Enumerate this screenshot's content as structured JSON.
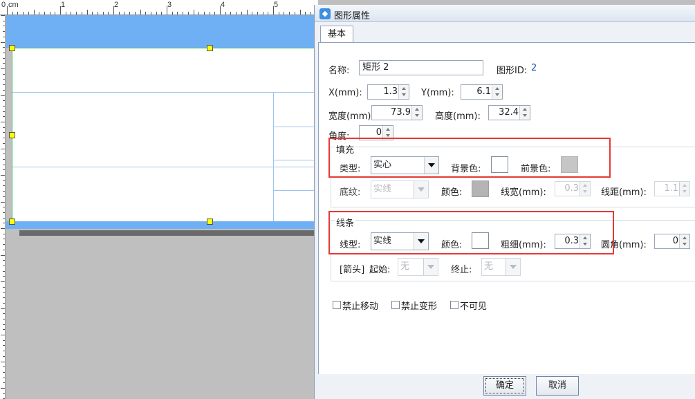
{
  "ruler": {
    "unit": "cm",
    "labels": [
      "1",
      "2",
      "3",
      "4",
      "5"
    ]
  },
  "dialog": {
    "title": "图形属性",
    "tab": "基本",
    "name_label": "名称:",
    "name_value": "矩形 2",
    "shape_id_label": "图形ID:",
    "shape_id_value": "2",
    "x_label": "X(mm):",
    "x_value": "1.3",
    "y_label": "Y(mm):",
    "y_value": "6.1",
    "width_label": "宽度(mm):",
    "width_value": "73.9",
    "height_label": "高度(mm):",
    "height_value": "32.4",
    "angle_label": "角度:",
    "angle_value": "0",
    "fill": {
      "section_title": "填充",
      "type_label": "类型:",
      "type_value": "实心",
      "bg_color_label": "背景色:",
      "bg_color": "#ffffff",
      "fg_color_label": "前景色:",
      "fg_color": "#c6c6c6",
      "pattern_label": "底纹:",
      "pattern_value": "实线",
      "color_label": "颜色:",
      "color": "#b4b4b4",
      "line_width_label": "线宽(mm):",
      "line_width_value": "0.3",
      "line_spacing_label": "线距(mm):",
      "line_spacing_value": "1.1"
    },
    "line": {
      "section_title": "线条",
      "type_label": "线型:",
      "type_value": "实线",
      "color_label": "颜色:",
      "color": "#ffffff",
      "thickness_label": "粗细(mm):",
      "thickness_value": "0.3",
      "corner_label": "圆角(mm):",
      "corner_value": "0",
      "arrow_label": "[箭头]",
      "start_label": "起始:",
      "start_value": "无",
      "end_label": "终止:",
      "end_value": "无"
    },
    "checkboxes": {
      "lock_move": "禁止移动",
      "lock_resize": "禁止变形",
      "invisible": "不可见"
    },
    "ok_button": "确定",
    "cancel_button": "取消"
  },
  "colors": {
    "band": "#6fb0f4",
    "highlight": "#e53935",
    "selection_border": "#34c75a",
    "handle": "#ffff00"
  }
}
